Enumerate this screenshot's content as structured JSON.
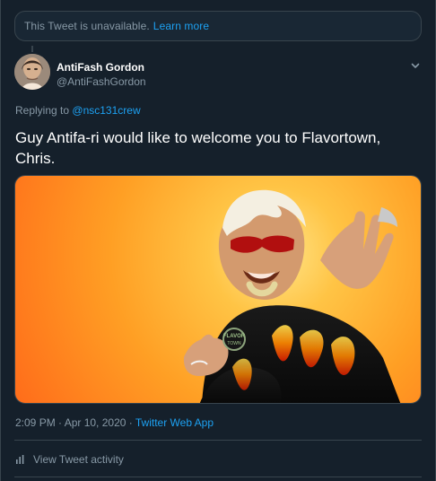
{
  "header": {
    "unavailable_text": "This Tweet is unavailable.",
    "learn_more_label": "Learn more"
  },
  "tweet": {
    "author_name": "AntiFash Gordon",
    "author_handle": "@AntiFashGordon",
    "replying_prefix": "Replying to",
    "replying_handle": "@nsc131crew",
    "text": "Guy Antifa-ri would like to welcome you to Flavortown, Chris.",
    "timestamp": "2:09 PM · Apr 10, 2020 · ",
    "app_label": "Twitter Web App"
  },
  "actions": {
    "view_activity_label": "View Tweet activity"
  },
  "icons": {
    "caret": "chevron-down-icon",
    "activity": "activity-icon"
  },
  "colors": {
    "background": "#15202b",
    "card_background": "#192734",
    "border": "#38444d",
    "primary_text": "#ffffff",
    "secondary_text": "#8899a6",
    "link": "#1da1f2",
    "media_orange": "#ff9f24"
  }
}
